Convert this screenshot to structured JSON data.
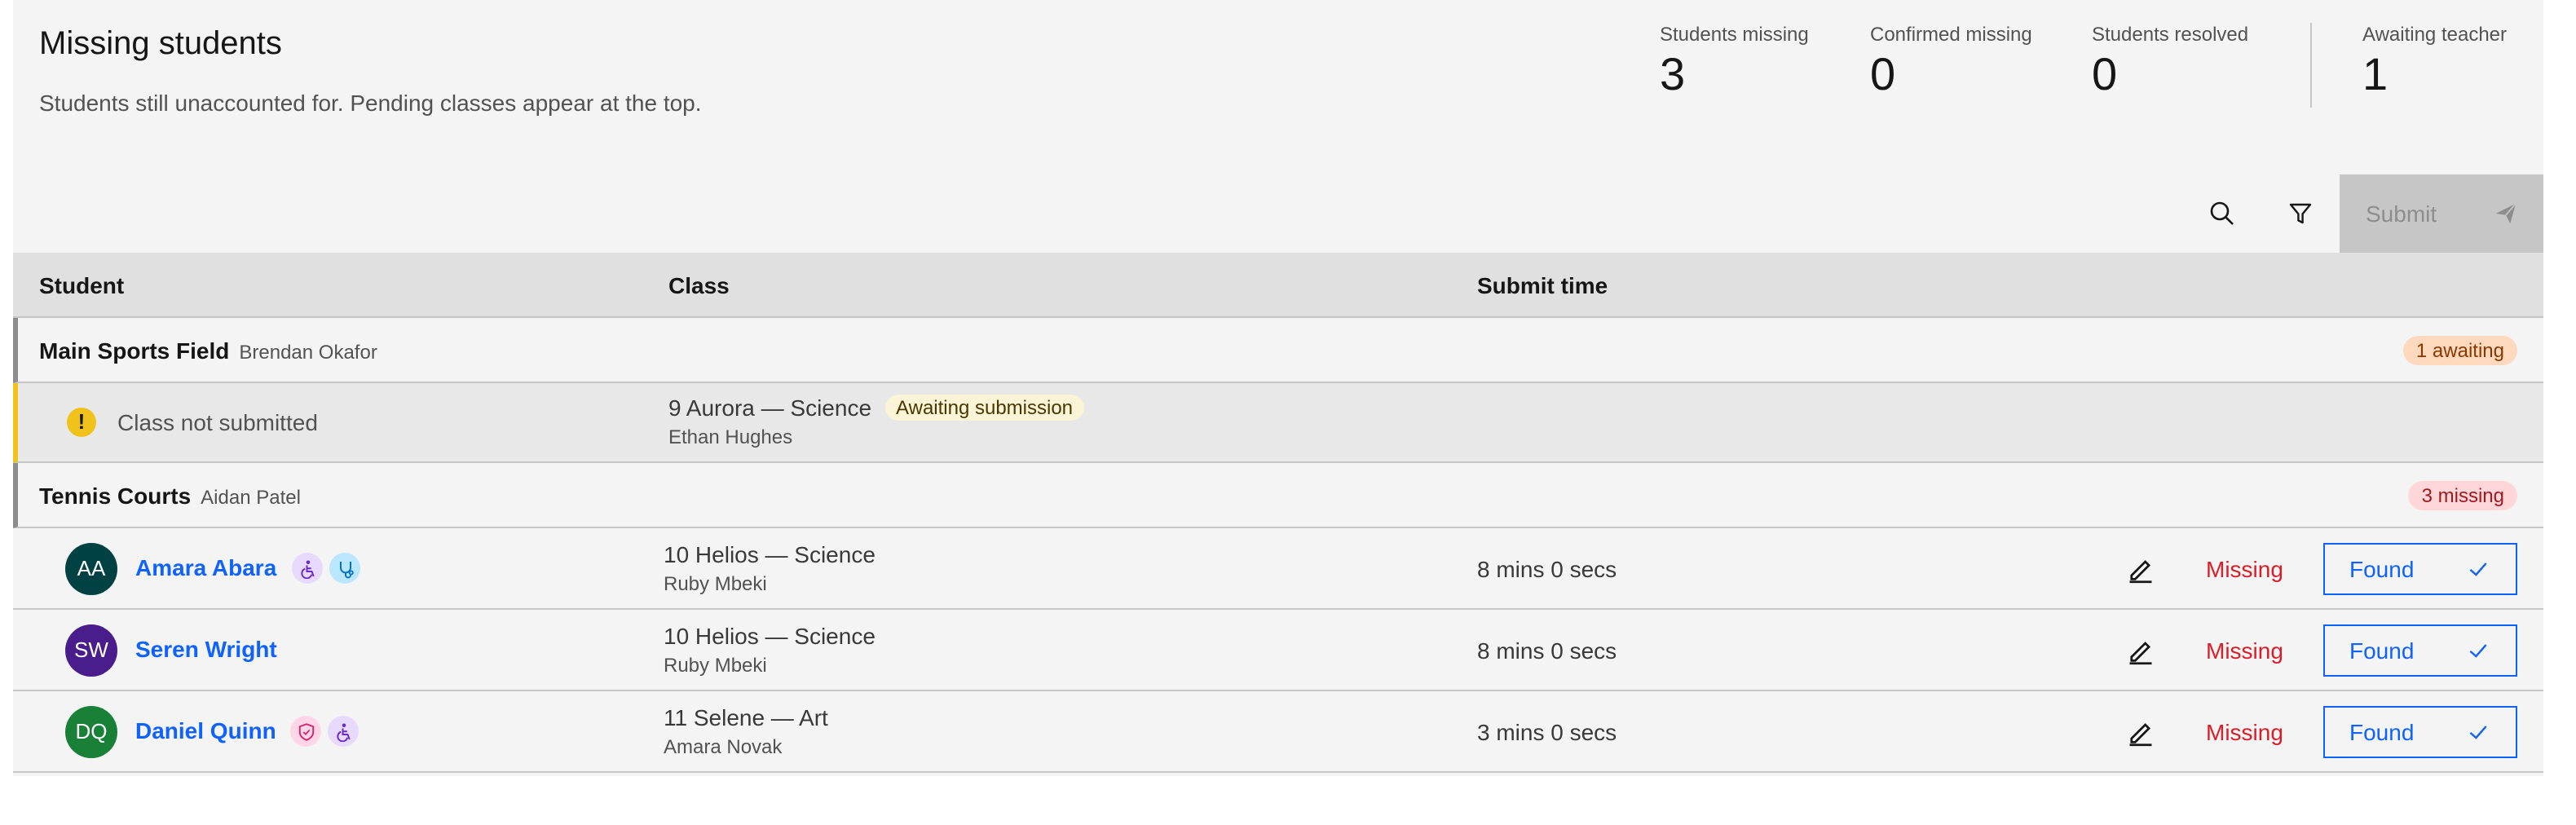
{
  "header": {
    "title": "Missing students",
    "subtitle": "Students still unaccounted for. Pending classes appear at the top."
  },
  "stats": [
    {
      "label": "Students missing",
      "value": "3"
    },
    {
      "label": "Confirmed missing",
      "value": "0"
    },
    {
      "label": "Students resolved",
      "value": "0"
    },
    {
      "label": "Awaiting teacher",
      "value": "1"
    }
  ],
  "toolbar": {
    "search_icon": "search-icon",
    "filter_icon": "filter-icon",
    "submit_label": "Submit",
    "submit_icon": "send-icon",
    "submit_disabled": true
  },
  "table": {
    "columns": [
      "Student",
      "Class",
      "Submit time"
    ]
  },
  "groups": [
    {
      "name": "Main Sports Field",
      "person": "Brendan Okafor",
      "tag": "1 awaiting",
      "tag_color": "#ffd9be",
      "pending": {
        "status": "Class not submitted",
        "class_name": "9 Aurora — Science",
        "tag": "Awaiting submission",
        "teacher": "Ethan Hughes"
      }
    },
    {
      "name": "Tennis Courts",
      "person": "Aidan Patel",
      "tag": "3 missing",
      "tag_color": "#ffd7d9",
      "students": [
        {
          "initials": "AA",
          "name": "Amara Abara",
          "avatar_color": "#004144",
          "badges": [
            "accessibility-icon",
            "medical-icon"
          ],
          "class_name": "10 Helios — Science",
          "teacher": "Ruby Mbeki",
          "submit_time": "8 mins 0 secs",
          "status": "Missing",
          "action": "Found"
        },
        {
          "initials": "SW",
          "name": "Seren Wright",
          "avatar_color": "#491d8b",
          "badges": [],
          "class_name": "10 Helios — Science",
          "teacher": "Ruby Mbeki",
          "submit_time": "8 mins 0 secs",
          "status": "Missing",
          "action": "Found"
        },
        {
          "initials": "DQ",
          "name": "Daniel Quinn",
          "avatar_color": "#198038",
          "badges": [
            "shield-icon",
            "accessibility-icon"
          ],
          "class_name": "11 Selene — Art",
          "teacher": "Amara Novak",
          "submit_time": "3 mins 0 secs",
          "status": "Missing",
          "action": "Found"
        }
      ]
    }
  ],
  "colors": {
    "accent": "#0f62fe",
    "missing": "#da1e28",
    "warning": "#f1c21b"
  }
}
